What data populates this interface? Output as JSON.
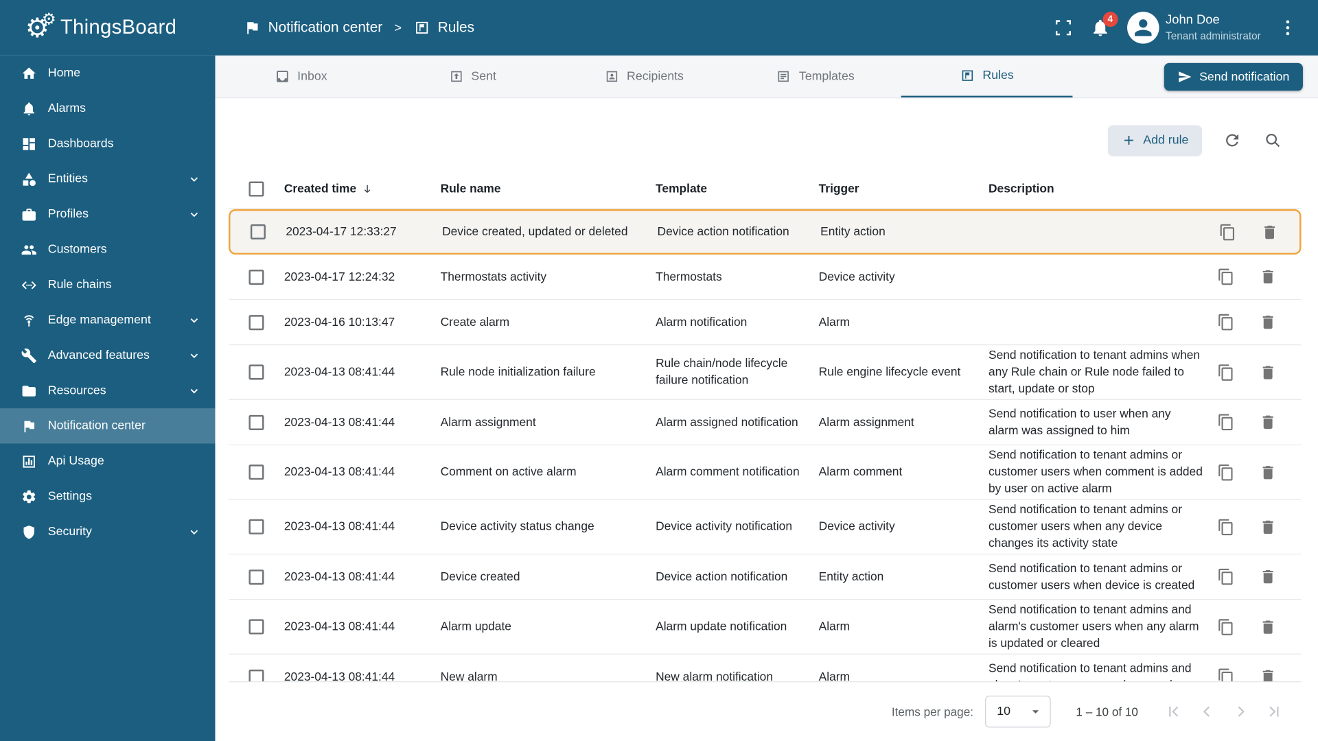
{
  "brand": {
    "name": "ThingsBoard"
  },
  "header": {
    "breadcrumb": {
      "parent": "Notification center",
      "separator": ">",
      "current": "Rules"
    },
    "notification_count": "4",
    "user": {
      "name": "John Doe",
      "role": "Tenant administrator"
    }
  },
  "sidebar": {
    "items": [
      {
        "label": "Home",
        "icon": "home"
      },
      {
        "label": "Alarms",
        "icon": "alarm-bell"
      },
      {
        "label": "Dashboards",
        "icon": "dashboards"
      },
      {
        "label": "Entities",
        "icon": "entities",
        "expandable": true
      },
      {
        "label": "Profiles",
        "icon": "profiles",
        "expandable": true
      },
      {
        "label": "Customers",
        "icon": "customers"
      },
      {
        "label": "Rule chains",
        "icon": "rule-chains"
      },
      {
        "label": "Edge management",
        "icon": "edge-management",
        "expandable": true
      },
      {
        "label": "Advanced features",
        "icon": "advanced-features",
        "expandable": true
      },
      {
        "label": "Resources",
        "icon": "resources",
        "expandable": true
      },
      {
        "label": "Notification center",
        "icon": "notification-center",
        "active": true
      },
      {
        "label": "Api Usage",
        "icon": "api-usage"
      },
      {
        "label": "Settings",
        "icon": "settings"
      },
      {
        "label": "Security",
        "icon": "security",
        "expandable": true
      }
    ]
  },
  "tabs": [
    {
      "label": "Inbox",
      "icon": "inbox"
    },
    {
      "label": "Sent",
      "icon": "sent"
    },
    {
      "label": "Recipients",
      "icon": "recipients"
    },
    {
      "label": "Templates",
      "icon": "templates"
    },
    {
      "label": "Rules",
      "icon": "rules",
      "active": true
    }
  ],
  "toolbar": {
    "send_notification_label": "Send notification",
    "add_rule_label": "Add rule"
  },
  "table": {
    "headers": {
      "created_time": "Created time",
      "rule_name": "Rule name",
      "template": "Template",
      "trigger": "Trigger",
      "description": "Description"
    },
    "rows": [
      {
        "created_time": "2023-04-17 12:33:27",
        "rule_name": "Device created, updated or deleted",
        "template": "Device action notification",
        "trigger": "Entity action",
        "description": "",
        "highlighted": true
      },
      {
        "created_time": "2023-04-17 12:24:32",
        "rule_name": "Thermostats activity",
        "template": "Thermostats",
        "trigger": "Device activity",
        "description": ""
      },
      {
        "created_time": "2023-04-16 10:13:47",
        "rule_name": "Create alarm",
        "template": "Alarm notification",
        "trigger": "Alarm",
        "description": ""
      },
      {
        "created_time": "2023-04-13 08:41:44",
        "rule_name": "Rule node initialization failure",
        "template": "Rule chain/node lifecycle failure notification",
        "trigger": "Rule engine lifecycle event",
        "description": "Send notification to tenant admins when any Rule chain or Rule node failed to start, update or stop"
      },
      {
        "created_time": "2023-04-13 08:41:44",
        "rule_name": "Alarm assignment",
        "template": "Alarm assigned notification",
        "trigger": "Alarm assignment",
        "description": "Send notification to user when any alarm was assigned to him"
      },
      {
        "created_time": "2023-04-13 08:41:44",
        "rule_name": "Comment on active alarm",
        "template": "Alarm comment notification",
        "trigger": "Alarm comment",
        "description": "Send notification to tenant admins or customer users when comment is added by user on active alarm"
      },
      {
        "created_time": "2023-04-13 08:41:44",
        "rule_name": "Device activity status change",
        "template": "Device activity notification",
        "trigger": "Device activity",
        "description": "Send notification to tenant admins or customer users when any device changes its activity state"
      },
      {
        "created_time": "2023-04-13 08:41:44",
        "rule_name": "Device created",
        "template": "Device action notification",
        "trigger": "Entity action",
        "description": "Send notification to tenant admins or customer users when device is created"
      },
      {
        "created_time": "2023-04-13 08:41:44",
        "rule_name": "Alarm update",
        "template": "Alarm update notification",
        "trigger": "Alarm",
        "description": "Send notification to tenant admins and alarm's customer users when any alarm is updated or cleared"
      },
      {
        "created_time": "2023-04-13 08:41:44",
        "rule_name": "New alarm",
        "template": "New alarm notification",
        "trigger": "Alarm",
        "description": "Send notification to tenant admins and alarm's customer users when an alarm"
      }
    ]
  },
  "pagination": {
    "items_per_page_label": "Items per page:",
    "page_size": "10",
    "range_label": "1 – 10 of 10"
  },
  "colors": {
    "primary": "#1b5e80",
    "highlight_border": "#efa53f",
    "badge": "#e5493d"
  }
}
